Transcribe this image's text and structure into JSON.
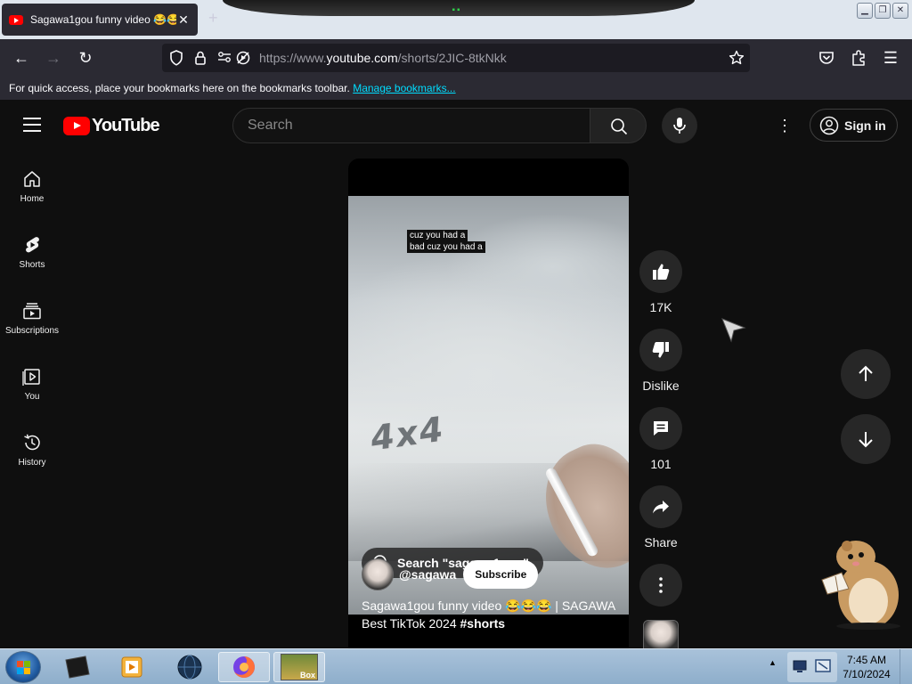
{
  "browser": {
    "tab_title": "Sagawa1gou funny video 😂😂😂",
    "new_tab_label": "+",
    "url_prefix": "https://www.",
    "url_domain": "youtube.com",
    "url_path": "/shorts/2JIC-8tkNkk",
    "bookmarks_message": "For quick access, place your bookmarks here on the bookmarks toolbar.",
    "bookmarks_link": "Manage bookmarks..."
  },
  "youtube": {
    "logo_text": "YouTube",
    "search_placeholder": "Search",
    "sign_in_label": "Sign in"
  },
  "sidebar": {
    "items": [
      {
        "label": "Home",
        "icon": "home-icon"
      },
      {
        "label": "Shorts",
        "icon": "shorts-icon"
      },
      {
        "label": "Subscriptions",
        "icon": "subscriptions-icon"
      },
      {
        "label": "You",
        "icon": "you-icon"
      },
      {
        "label": "History",
        "icon": "history-icon"
      }
    ]
  },
  "short": {
    "caption_line1": "cuz you had a",
    "caption_line2": "bad cuz you had a",
    "overlay_text": "4x4",
    "search_pill": "Search \"sagawa1gou\"",
    "channel": "@sagawa",
    "subscribe_label": "Subscribe",
    "title_main": "Sagawa1gou funny video 😂😂😂 | SAGAWA Best TikTok 2024 ",
    "title_tag": "#shorts"
  },
  "actions": {
    "like_count": "17K",
    "dislike_label": "Dislike",
    "comment_count": "101",
    "share_label": "Share"
  },
  "taskbar": {
    "time": "7:45 AM",
    "date": "7/10/2024",
    "box_label": "Box"
  },
  "colors": {
    "youtube_red": "#ff0000",
    "page_bg": "#0f0f0f",
    "browser_chrome": "#2b2a33",
    "link": "#00ddff"
  }
}
